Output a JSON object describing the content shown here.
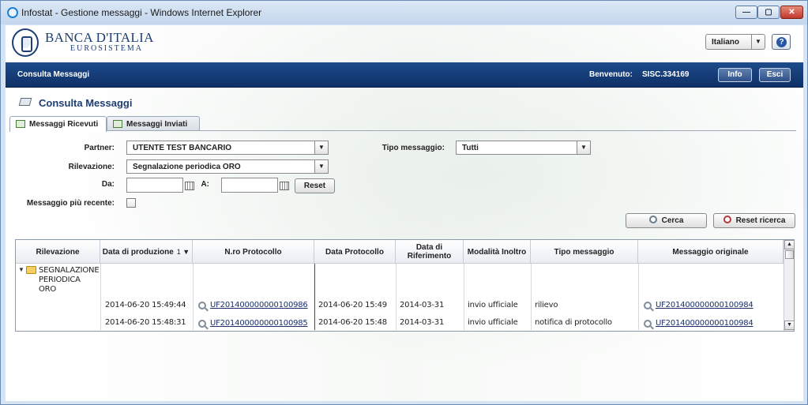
{
  "window": {
    "title": "Infostat - Gestione messaggi - Windows Internet Explorer",
    "controls": {
      "minimize": "—",
      "maximize": "▢",
      "close": "✕"
    }
  },
  "header": {
    "bank_name": "BANCA D'ITALIA",
    "bank_sub": "EUROSISTEMA",
    "language": "Italiano",
    "help": "?"
  },
  "navbar": {
    "section": "Consulta Messaggi",
    "welcome_label": "Benvenuto:",
    "user": "SISC.334169",
    "info_label": "Info",
    "esci_label": "Esci"
  },
  "page": {
    "title": "Consulta Messaggi",
    "tabs": [
      {
        "label": "Messaggi Ricevuti",
        "active": true
      },
      {
        "label": "Messaggi Inviati",
        "active": false
      }
    ]
  },
  "filters": {
    "partner_label": "Partner:",
    "partner_value": "UTENTE TEST BANCARIO",
    "tipo_label": "Tipo messaggio:",
    "tipo_value": "Tutti",
    "rilevazione_label": "Rilevazione:",
    "rilevazione_value": "Segnalazione periodica ORO",
    "da_label": "Da:",
    "a_label": "A:",
    "reset_label": "Reset",
    "recente_label": "Messaggio più recente:",
    "cerca_label": "Cerca",
    "reset_ricerca_label": "Reset ricerca"
  },
  "grid": {
    "columns": [
      "Rilevazione",
      "Data di produzione",
      "N.ro Protocollo",
      "Data Protocollo",
      "Data di Riferimento",
      "Modalità Inoltro",
      "Tipo messaggio",
      "Messaggio originale"
    ],
    "sort_indicator": "1 ▼",
    "group": {
      "line1": "SEGNALAZIONE",
      "line2": "PERIODICA",
      "line3": "ORO"
    },
    "rows": [
      {
        "data_produzione": "2014-06-20 15:49:44",
        "protocollo": "UF201400000000100986",
        "data_protocollo": "2014-06-20 15:49",
        "data_riferimento": "2014-03-31",
        "modalita": "invio ufficiale",
        "tipo": "rilievo",
        "originale": "UF201400000000100984"
      },
      {
        "data_produzione": "2014-06-20 15:48:31",
        "protocollo": "UF201400000000100985",
        "data_protocollo": "2014-06-20 15:48",
        "data_riferimento": "2014-03-31",
        "modalita": "invio ufficiale",
        "tipo": "notifica di protocollo",
        "originale": "UF201400000000100984"
      }
    ]
  }
}
